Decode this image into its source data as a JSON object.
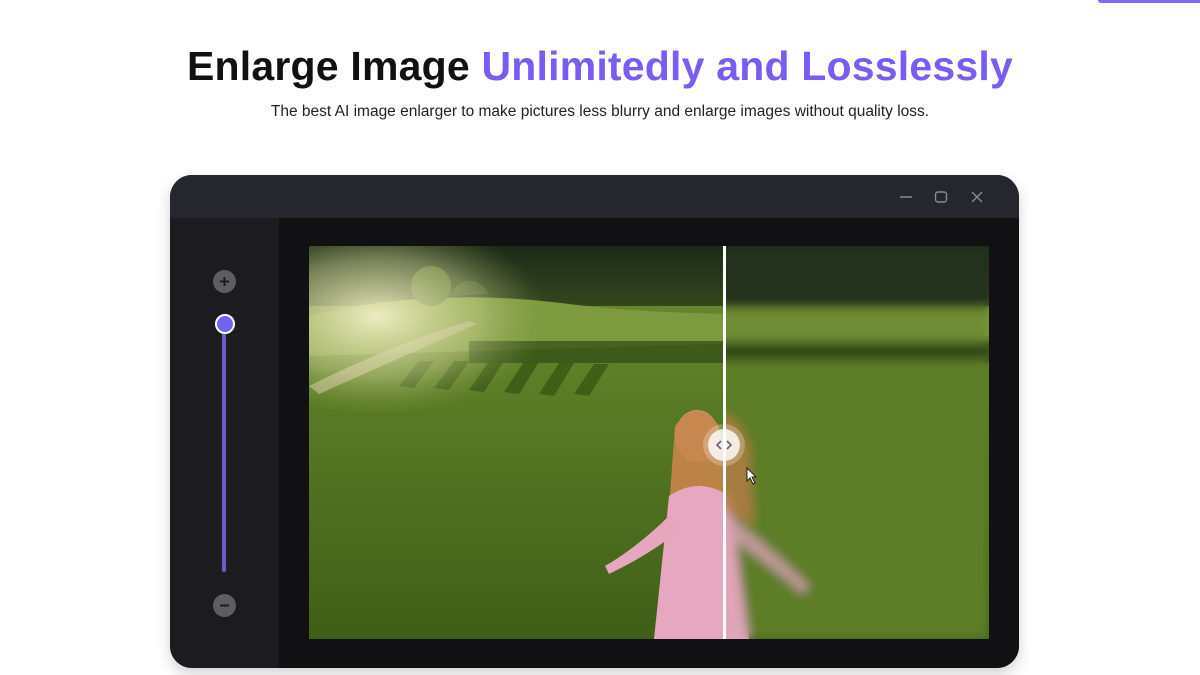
{
  "heading": {
    "part1": "Enlarge Image ",
    "part2": "Unlimitedly and Losslessly"
  },
  "subtitle": "The best AI image enlarger to make pictures less blurry and enlarge images without quality loss.",
  "window_controls": [
    "minimize-icon",
    "maximize-icon",
    "close-icon"
  ],
  "zoom": {
    "icons": [
      "plus-icon",
      "minus-icon"
    ],
    "level": 1.0
  },
  "comparison": {
    "split_fraction": 0.61,
    "left_side": "sharp",
    "right_side": "blurry",
    "icons": [
      "chevron-left-icon",
      "chevron-right-icon",
      "cursor-icon"
    ]
  },
  "colors": {
    "accent": "#7a5cf4",
    "window_bg": "#141416",
    "titlebar": "#26262e",
    "sidebar": "#1b1b20"
  }
}
